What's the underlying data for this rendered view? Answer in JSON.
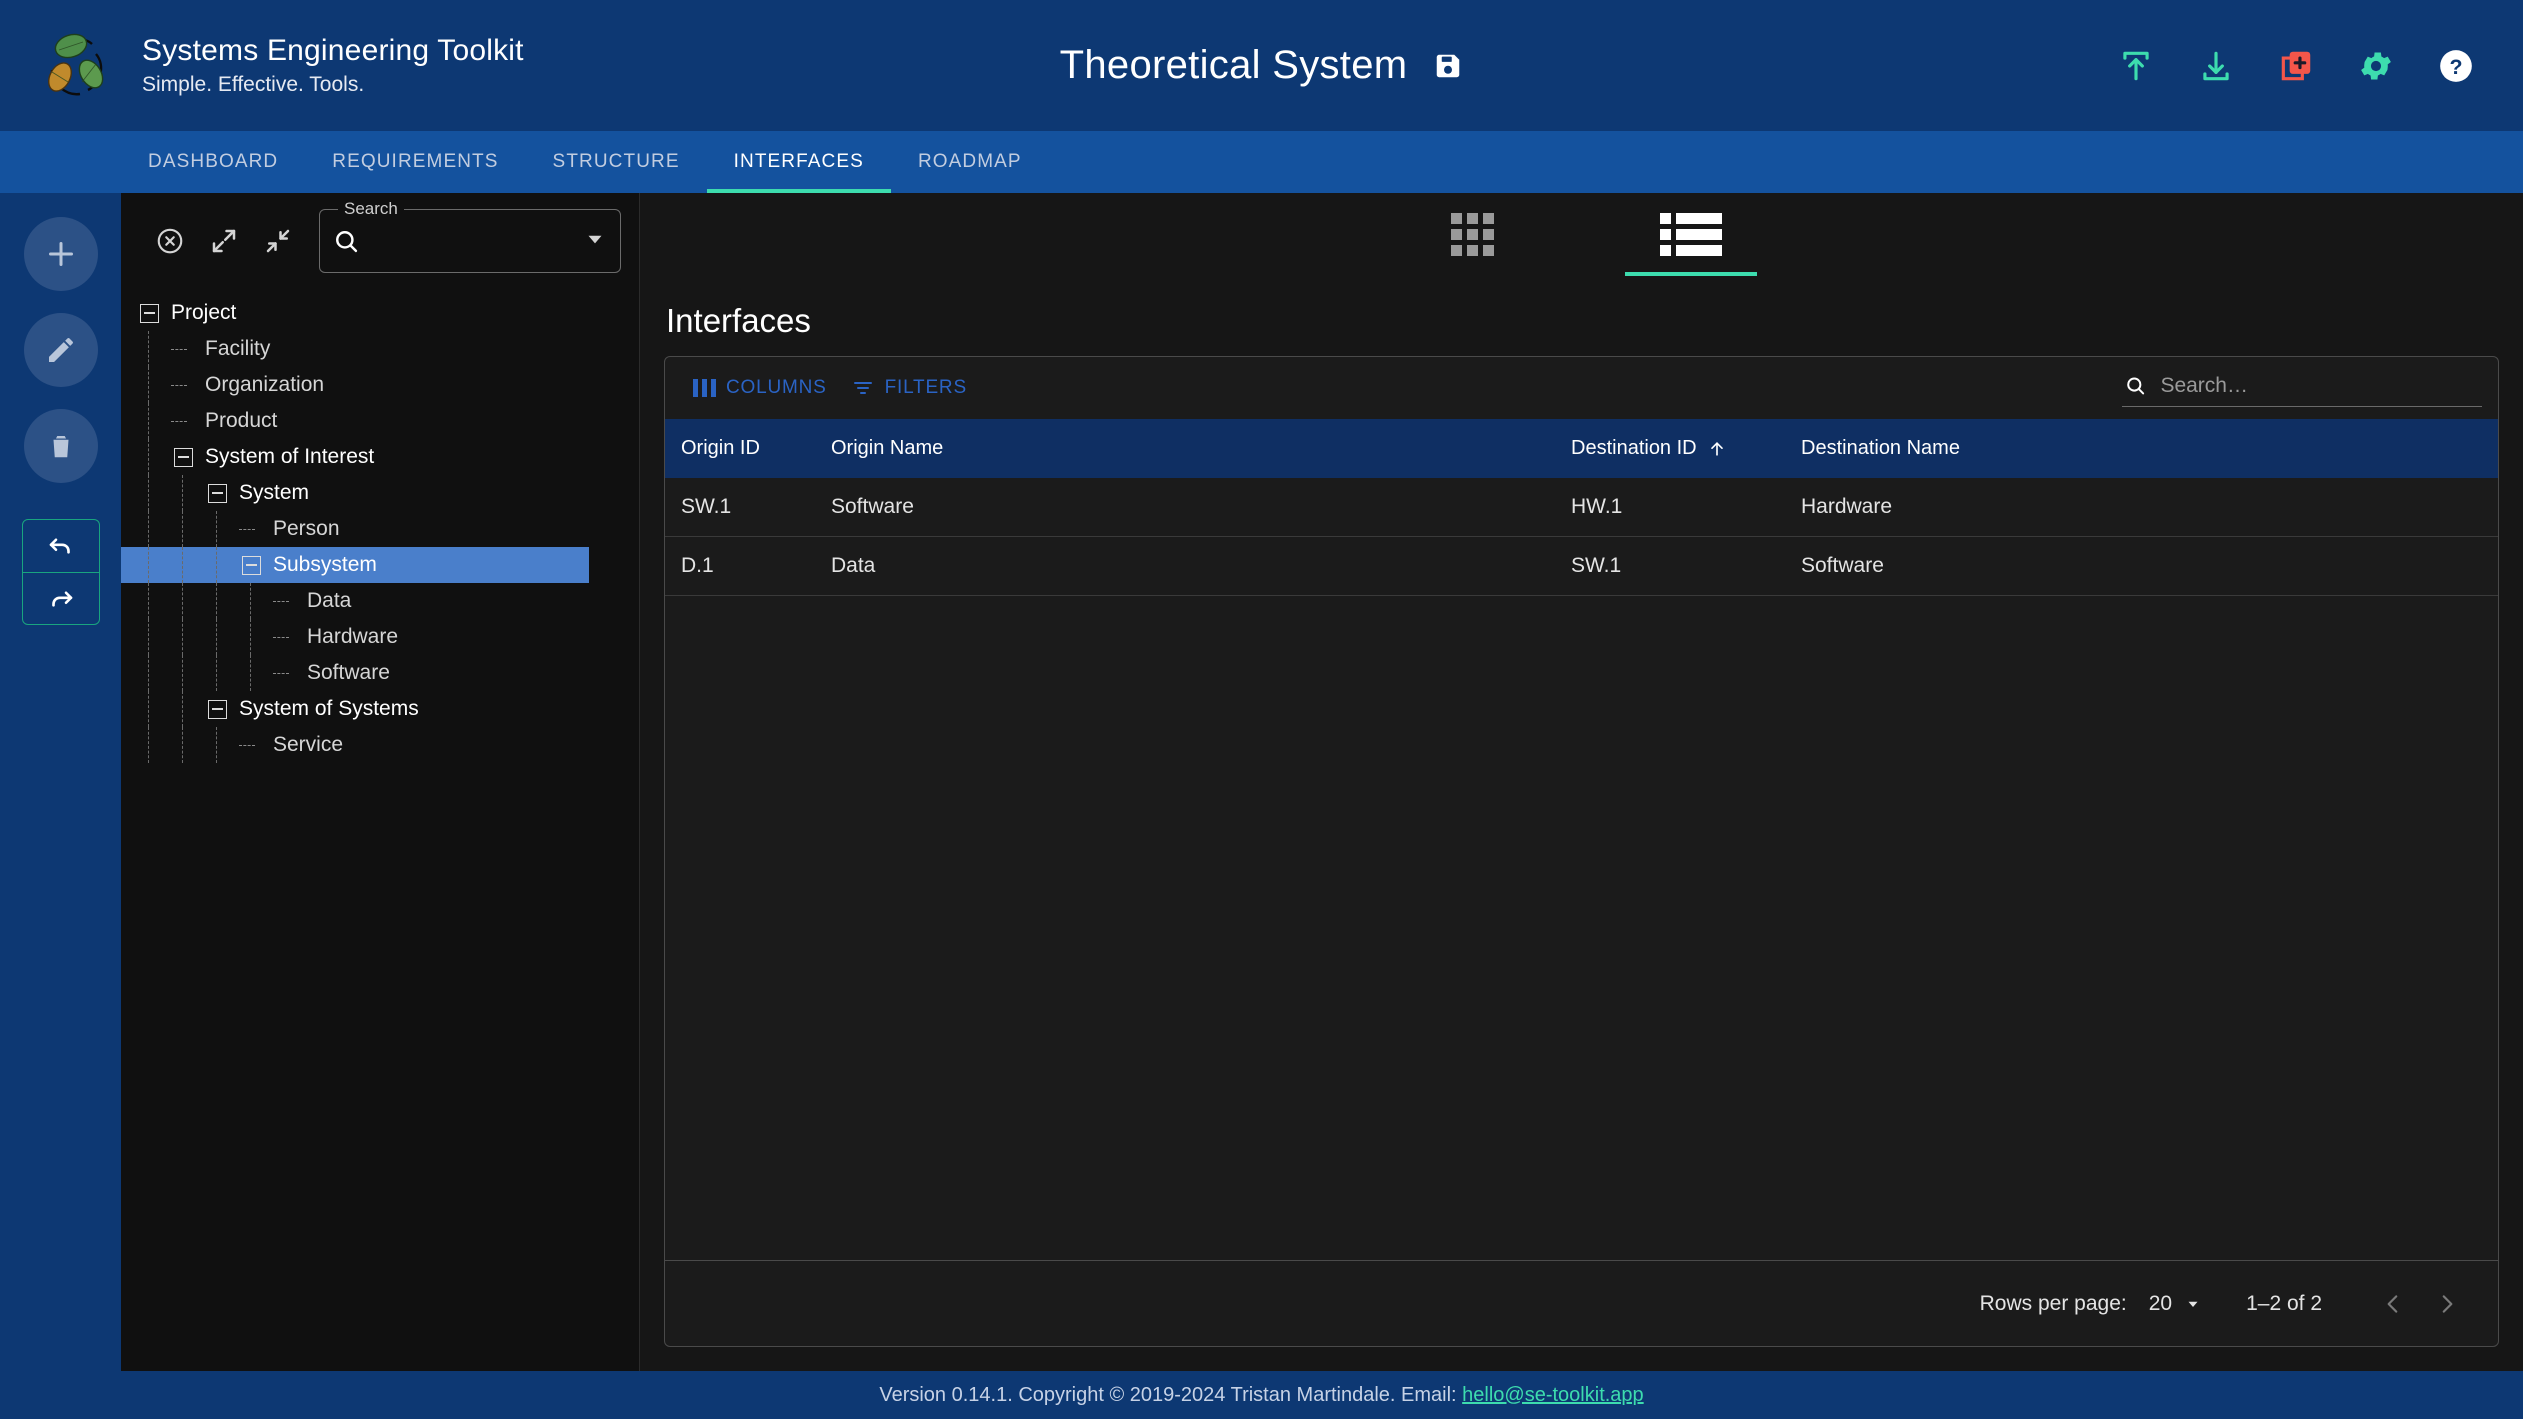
{
  "header": {
    "brand_title": "Systems Engineering Toolkit",
    "brand_tagline": "Simple. Effective. Tools.",
    "document_title": "Theoretical System",
    "save_icon": "save-floppy-icon",
    "actions": [
      {
        "name": "upload-icon",
        "color": "#3ddcae"
      },
      {
        "name": "download-icon",
        "color": "#3ddcae"
      },
      {
        "name": "new-document-icon",
        "color": "#f4564a"
      },
      {
        "name": "settings-gear-icon",
        "color": "#3ddcae"
      },
      {
        "name": "help-icon",
        "color": "#ffffff"
      }
    ]
  },
  "tabs": [
    {
      "label": "DASHBOARD",
      "active": false
    },
    {
      "label": "REQUIREMENTS",
      "active": false
    },
    {
      "label": "STRUCTURE",
      "active": false
    },
    {
      "label": "INTERFACES",
      "active": true
    },
    {
      "label": "ROADMAP",
      "active": false
    }
  ],
  "rail": {
    "add_label": "add-icon",
    "edit_label": "edit-pencil-icon",
    "delete_label": "delete-trash-icon",
    "undo_label": "undo-icon",
    "redo_label": "redo-icon"
  },
  "tree_panel": {
    "tools": [
      {
        "name": "clear-selection-icon"
      },
      {
        "name": "expand-all-icon"
      },
      {
        "name": "collapse-all-icon"
      }
    ],
    "search": {
      "label": "Search",
      "value": "",
      "placeholder": ""
    },
    "nodes": [
      {
        "label": "Project",
        "depth": 0,
        "toggle": "minus",
        "selected": false,
        "bold": true
      },
      {
        "label": "Facility",
        "depth": 1,
        "toggle": "leaf",
        "selected": false,
        "bold": false
      },
      {
        "label": "Organization",
        "depth": 1,
        "toggle": "leaf",
        "selected": false,
        "bold": false
      },
      {
        "label": "Product",
        "depth": 1,
        "toggle": "leaf",
        "selected": false,
        "bold": false
      },
      {
        "label": "System of Interest",
        "depth": 1,
        "toggle": "minus",
        "selected": false,
        "bold": true
      },
      {
        "label": "System",
        "depth": 2,
        "toggle": "minus",
        "selected": false,
        "bold": true
      },
      {
        "label": "Person",
        "depth": 3,
        "toggle": "leaf",
        "selected": false,
        "bold": false
      },
      {
        "label": "Subsystem",
        "depth": 3,
        "toggle": "minus",
        "selected": true,
        "bold": true
      },
      {
        "label": "Data",
        "depth": 4,
        "toggle": "leaf",
        "selected": false,
        "bold": false
      },
      {
        "label": "Hardware",
        "depth": 4,
        "toggle": "leaf",
        "selected": false,
        "bold": false
      },
      {
        "label": "Software",
        "depth": 4,
        "toggle": "leaf",
        "selected": false,
        "bold": false
      },
      {
        "label": "System of Systems",
        "depth": 2,
        "toggle": "minus",
        "selected": false,
        "bold": true
      },
      {
        "label": "Service",
        "depth": 3,
        "toggle": "leaf",
        "selected": false,
        "bold": false
      }
    ]
  },
  "view_toggle": {
    "grid_view": {
      "name": "grid-view-icon",
      "active": false
    },
    "list_view": {
      "name": "list-view-icon",
      "active": true
    }
  },
  "main": {
    "title": "Interfaces",
    "toolbar": {
      "columns_label": "COLUMNS",
      "filters_label": "FILTERS",
      "search_placeholder": "Search…",
      "search_value": ""
    },
    "table": {
      "columns": [
        {
          "label": "Origin ID",
          "sorted": false
        },
        {
          "label": "Origin Name",
          "sorted": false
        },
        {
          "label": "Destination ID",
          "sorted": true,
          "sort_direction": "asc"
        },
        {
          "label": "Destination Name",
          "sorted": false
        }
      ],
      "rows": [
        {
          "origin_id": "SW.1",
          "origin_name": "Software",
          "destination_id": "HW.1",
          "destination_name": "Hardware"
        },
        {
          "origin_id": "D.1",
          "origin_name": "Data",
          "destination_id": "SW.1",
          "destination_name": "Software"
        }
      ]
    },
    "pagination": {
      "rows_per_page_label": "Rows per page:",
      "rows_per_page_value": "20",
      "range_label": "1–2 of 2",
      "prev_label": "previous-page-icon",
      "next_label": "next-page-icon"
    }
  },
  "footer": {
    "text": "Version 0.14.1. Copyright © 2019-2024 Tristan Martindale. Email: ",
    "email": "hello@se-toolkit.app"
  },
  "colors": {
    "brand_blue": "#0d3873",
    "tab_blue": "#14529e",
    "accent_teal": "#3ddcae",
    "accent_red": "#f4564a",
    "link_blue": "#2a63c4",
    "header_row": "#0f2f63",
    "selection_blue": "#4a7fcb",
    "panel_dark": "#161616"
  }
}
